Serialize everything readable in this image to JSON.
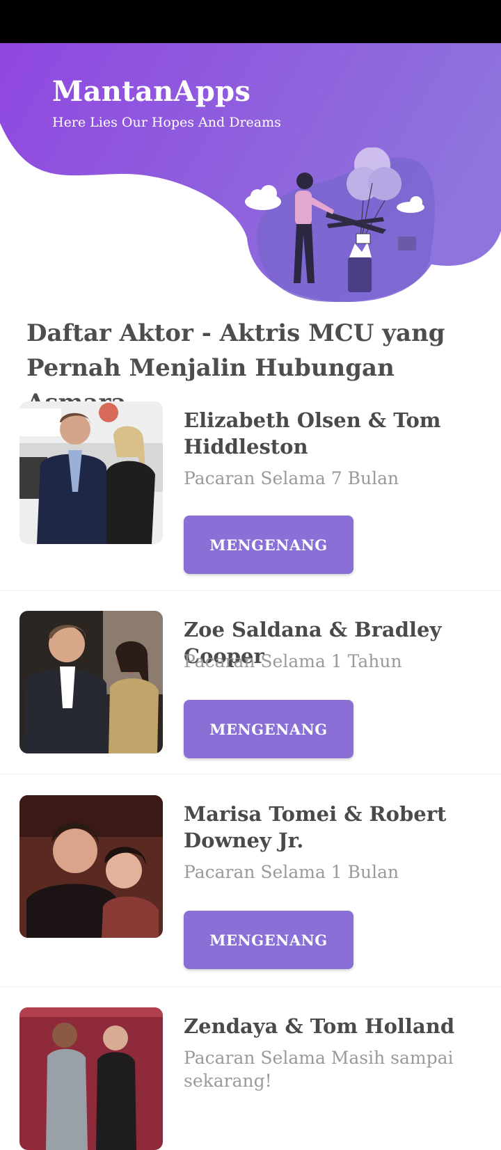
{
  "app": {
    "title": "MantanApps",
    "subtitle": "Here Lies Our Hopes And Dreams"
  },
  "colors": {
    "accent": "#8a6fd6",
    "header_start": "#9047e0",
    "header_end": "#8e74dc"
  },
  "section": {
    "title": "Daftar Aktor - Aktris MCU yang Pernah Menjalin Hubungan Asmara"
  },
  "couples": [
    {
      "title": "Elizabeth Olsen & Tom Hiddleston",
      "duration": "Pacaran Selama 7 Bulan",
      "button_label": "MENGENANG"
    },
    {
      "title": "Zoe Saldana & Bradley Cooper",
      "duration": "Pacaran Selama 1 Tahun",
      "button_label": "MENGENANG"
    },
    {
      "title": "Marisa Tomei & Robert Downey Jr.",
      "duration": "Pacaran Selama 1 Bulan",
      "button_label": "MENGENANG"
    },
    {
      "title": "Zendaya & Tom Holland",
      "duration": "Pacaran Selama Masih sampai sekarang!"
    }
  ]
}
